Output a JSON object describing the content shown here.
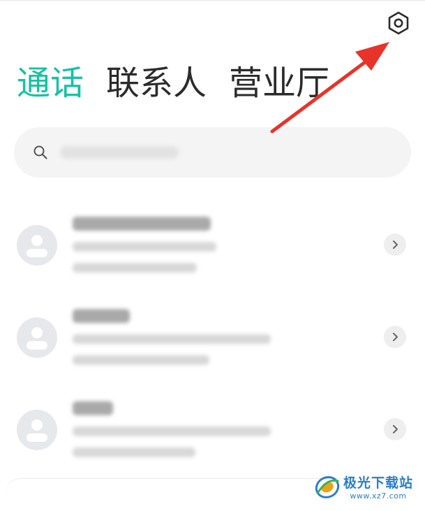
{
  "header": {
    "settings_icon": "settings-hexagon-icon",
    "tabs": [
      {
        "label": "通话",
        "active": true
      },
      {
        "label": "联系人",
        "active": false
      },
      {
        "label": "营业厅",
        "active": false
      }
    ]
  },
  "search": {
    "icon": "search-icon"
  },
  "call_log": {
    "items_visible": 3,
    "avatar_icon": "person-avatar-icon",
    "row_action_icon": "chevron-right-icon"
  },
  "annotation": {
    "arrow_color": "#e8332a",
    "points_to": "settings"
  },
  "watermark": {
    "title": "极光下载站",
    "url": "www.xz7.com"
  },
  "colors": {
    "accent": "#16c2a3",
    "text_primary": "#2b2b2b",
    "search_bg": "#f4f4f4",
    "avatar_bg": "#e6e8ec",
    "watermark_blue": "#2a7fc8"
  }
}
